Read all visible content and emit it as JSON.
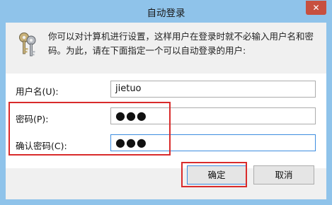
{
  "window": {
    "title": "自动登录",
    "close_glyph": "✕"
  },
  "description": "你可以对计算机进行设置，这样用户在登录时就不必输入用户名和密码。为此，请在下面指定一个可以自动登录的用户:",
  "form": {
    "username_label": "用户名(U):",
    "username_value": "jietuo",
    "password_label": "密码(P):",
    "password_value": "●●●",
    "confirm_label": "确认密码(C):",
    "confirm_value": "●●●"
  },
  "buttons": {
    "ok_label": "确定",
    "cancel_label": "取消"
  },
  "icons": {
    "app_icon": "keys-icon"
  },
  "colors": {
    "title_bar": "#8fc3ea",
    "close_button": "#c7503f",
    "highlight_red": "#d92b2b",
    "focus_blue": "#3d8de0"
  }
}
